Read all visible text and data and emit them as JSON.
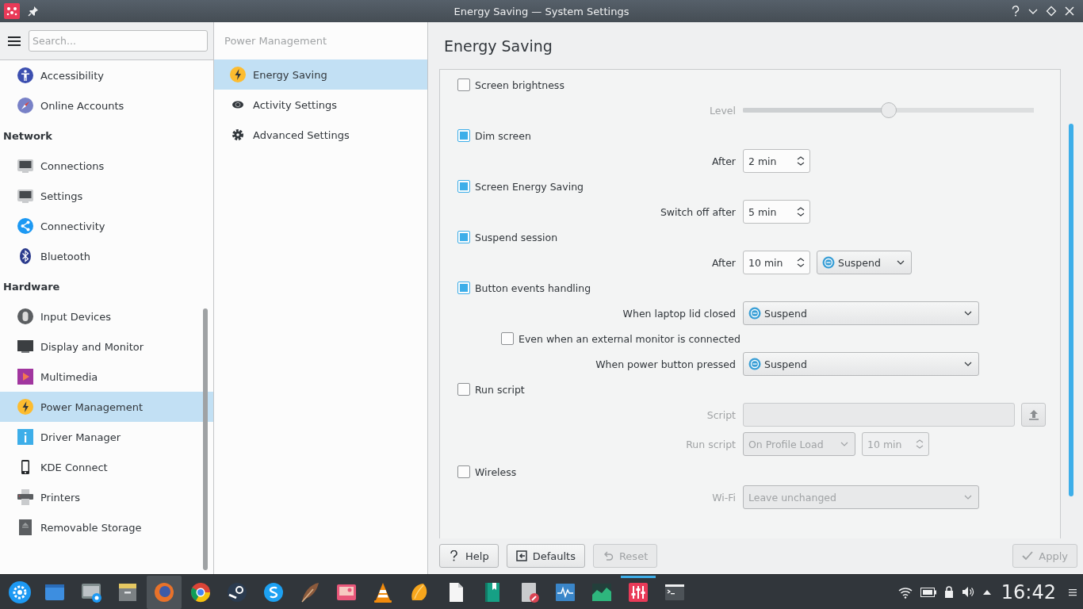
{
  "window": {
    "title": "Energy Saving — System Settings"
  },
  "sidebar": {
    "search": {
      "placeholder": "Search..."
    },
    "items": [
      {
        "kind": "item",
        "label": "Accessibility",
        "selected": false
      },
      {
        "kind": "item",
        "label": "Online Accounts",
        "selected": false
      },
      {
        "kind": "category",
        "label": "Network"
      },
      {
        "kind": "item",
        "label": "Connections",
        "selected": false
      },
      {
        "kind": "item",
        "label": "Settings",
        "selected": false
      },
      {
        "kind": "item",
        "label": "Connectivity",
        "selected": false
      },
      {
        "kind": "item",
        "label": "Bluetooth",
        "selected": false
      },
      {
        "kind": "category",
        "label": "Hardware"
      },
      {
        "kind": "item",
        "label": "Input Devices",
        "selected": false
      },
      {
        "kind": "item",
        "label": "Display and Monitor",
        "selected": false
      },
      {
        "kind": "item",
        "label": "Multimedia",
        "selected": false
      },
      {
        "kind": "item",
        "label": "Power Management",
        "selected": true
      },
      {
        "kind": "item",
        "label": "Driver Manager",
        "selected": false
      },
      {
        "kind": "item",
        "label": "KDE Connect",
        "selected": false
      },
      {
        "kind": "item",
        "label": "Printers",
        "selected": false
      },
      {
        "kind": "item",
        "label": "Removable Storage",
        "selected": false
      }
    ]
  },
  "subnav": {
    "title": "Power Management",
    "items": [
      {
        "label": "Energy Saving",
        "selected": true
      },
      {
        "label": "Activity Settings",
        "selected": false
      },
      {
        "label": "Advanced Settings",
        "selected": false
      }
    ]
  },
  "page": {
    "title": "Energy Saving",
    "rows": [
      {
        "kind": "check",
        "label": "Screen brightness",
        "checked": false
      },
      {
        "kind": "slider",
        "label": "Level",
        "level": 0.5,
        "disabled": true
      },
      {
        "kind": "check",
        "label": "Dim screen",
        "checked": true
      },
      {
        "kind": "field",
        "label": "After",
        "disabled": false,
        "controls": [
          {
            "kind": "spin",
            "value": "2 min"
          }
        ]
      },
      {
        "kind": "check",
        "label": "Screen Energy Saving",
        "checked": true
      },
      {
        "kind": "field",
        "label": "Switch off after",
        "disabled": false,
        "controls": [
          {
            "kind": "spin",
            "value": "5 min"
          }
        ]
      },
      {
        "kind": "check",
        "label": "Suspend session",
        "checked": true
      },
      {
        "kind": "field",
        "label": "After",
        "disabled": false,
        "controls": [
          {
            "kind": "spin",
            "value": "10 min"
          },
          {
            "kind": "action-combo",
            "value": "Suspend"
          }
        ]
      },
      {
        "kind": "check",
        "label": "Button events handling",
        "checked": true
      },
      {
        "kind": "field",
        "label": "When laptop lid closed",
        "disabled": false,
        "controls": [
          {
            "kind": "action-combo",
            "value": "Suspend"
          }
        ]
      },
      {
        "kind": "subcheck",
        "label": "Even when an external monitor is connected",
        "checked": false
      },
      {
        "kind": "field",
        "label": "When power button pressed",
        "disabled": false,
        "controls": [
          {
            "kind": "action-combo",
            "value": "Suspend"
          }
        ]
      },
      {
        "kind": "check",
        "label": "Run script",
        "checked": false
      },
      {
        "kind": "field",
        "label": "Script",
        "disabled": true,
        "controls": [
          {
            "kind": "file"
          }
        ]
      },
      {
        "kind": "field",
        "label": "Run script",
        "disabled": true,
        "controls": [
          {
            "kind": "combo",
            "value": "On Profile Load"
          },
          {
            "kind": "spin",
            "value": "10 min"
          }
        ]
      },
      {
        "kind": "check",
        "label": "Wireless",
        "checked": false
      },
      {
        "kind": "field",
        "label": "Wi-Fi",
        "disabled": true,
        "controls": [
          {
            "kind": "combo",
            "value": "Leave unchanged"
          }
        ]
      }
    ],
    "buttons": [
      {
        "label": "Help",
        "disabled": false
      },
      {
        "label": "Defaults",
        "disabled": false
      },
      {
        "label": "Reset",
        "disabled": true
      },
      {
        "label": "Apply",
        "disabled": true
      }
    ]
  },
  "taskbar": {
    "tasks": [
      {
        "selected": false,
        "attention": false
      },
      {
        "selected": false,
        "attention": false
      },
      {
        "selected": false,
        "attention": false
      },
      {
        "selected": true,
        "attention": false
      },
      {
        "selected": false,
        "attention": false
      },
      {
        "selected": false,
        "attention": false
      },
      {
        "selected": false,
        "attention": false
      },
      {
        "selected": false,
        "attention": false
      },
      {
        "selected": false,
        "attention": false
      },
      {
        "selected": false,
        "attention": false
      },
      {
        "selected": false,
        "attention": false
      },
      {
        "selected": false,
        "attention": false
      },
      {
        "selected": false,
        "attention": false
      },
      {
        "selected": false,
        "attention": false
      },
      {
        "selected": false,
        "attention": false
      },
      {
        "selected": false,
        "attention": false
      },
      {
        "selected": false,
        "attention": true
      },
      {
        "selected": false,
        "attention": false
      }
    ],
    "clock": "16:42"
  }
}
